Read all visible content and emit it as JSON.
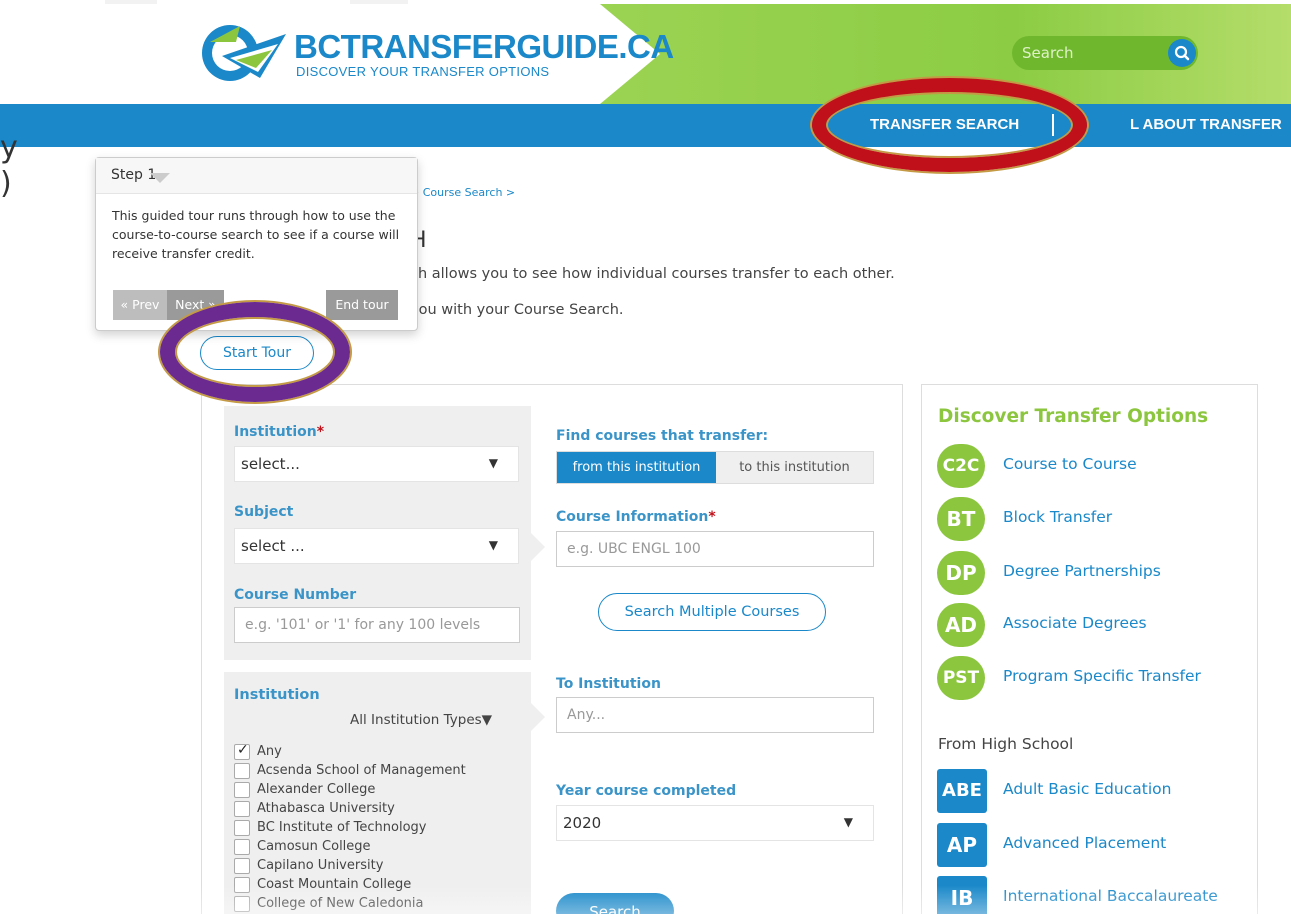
{
  "header": {
    "logo_title": "BCTRANSFERGUIDE.CA",
    "logo_subtitle": "DISCOVER YOUR TRANSFER OPTIONS",
    "search_placeholder": "Search",
    "nav": {
      "transfer_search": "TRANSFER SEARCH",
      "all_about_transfer": "L ABOUT TRANSFER"
    }
  },
  "edge_text": {
    "line1": "y",
    "line2": ")"
  },
  "breadcrumb": {
    "sep": ">",
    "item": "Course Search",
    "trail": ">"
  },
  "page": {
    "heading_fragment": "H",
    "intro_line1": "ch allows you to see how individual courses transfer to each other.",
    "intro_line2": "you with your Course Search.",
    "start_tour": "Start Tour"
  },
  "tour": {
    "title": "Step 1",
    "body": "This guided tour runs through how to use the course-to-course search to see if a course will receive transfer credit.",
    "prev": "« Prev",
    "next": "Next »",
    "end": "End tour"
  },
  "form": {
    "institution_label": "Institution",
    "required_mark": "*",
    "institution_value": "select...",
    "subject_label": "Subject",
    "subject_value": "select ...",
    "course_number_label": "Course Number",
    "course_number_placeholder": "e.g. '101' or '1' for any 100 levels",
    "find_label": "Find courses that transfer:",
    "toggle_from": "from this institution",
    "toggle_to": "to this institution",
    "course_info_label": "Course Information",
    "course_info_placeholder": "e.g. UBC ENGL 100",
    "multi_button": "Search Multiple Courses",
    "institution_filter_label": "Institution",
    "institution_types": "All Institution Types▼",
    "to_institution_label": "To Institution",
    "to_institution_placeholder": "Any...",
    "year_label": "Year course completed",
    "year_value": "2020",
    "search_button": "Search",
    "caret": "▼",
    "institutions": [
      {
        "label": "Any",
        "checked": true
      },
      {
        "label": "Acsenda School of Management",
        "checked": false
      },
      {
        "label": "Alexander College",
        "checked": false
      },
      {
        "label": "Athabasca University",
        "checked": false
      },
      {
        "label": "BC Institute of Technology",
        "checked": false
      },
      {
        "label": "Camosun College",
        "checked": false
      },
      {
        "label": "Capilano University",
        "checked": false
      },
      {
        "label": "Coast Mountain College",
        "checked": false
      },
      {
        "label": "College of New Caledonia",
        "checked": false
      }
    ]
  },
  "sidebar": {
    "title": "Discover Transfer Options",
    "items": [
      {
        "badge": "C2C",
        "label": "Course to Course"
      },
      {
        "badge": "BT",
        "label": "Block Transfer"
      },
      {
        "badge": "DP",
        "label": "Degree Partnerships"
      },
      {
        "badge": "AD",
        "label": "Associate Degrees"
      },
      {
        "badge": "PST",
        "label": "Program Specific Transfer"
      }
    ],
    "high_school_heading": "From High School",
    "hs_items": [
      {
        "badge": "ABE",
        "label": "Adult Basic Education"
      },
      {
        "badge": "AP",
        "label": "Advanced Placement"
      },
      {
        "badge": "IB",
        "label": "International Baccalaureate"
      }
    ]
  },
  "colors": {
    "brand_blue": "#1a88c9",
    "brand_green": "#8cc63f",
    "annotation_red": "#c0101a",
    "annotation_purple": "#6a2a90"
  }
}
